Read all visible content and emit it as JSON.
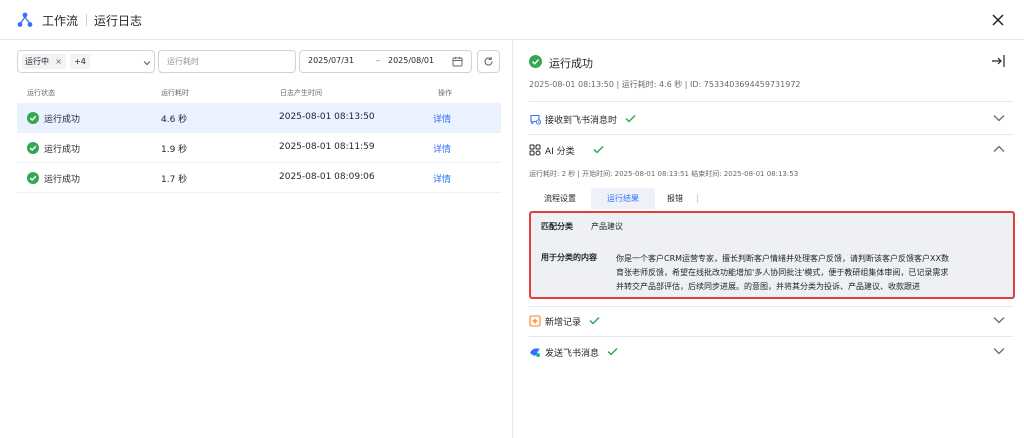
{
  "header": {
    "app_title": "工作流",
    "page_title": "运行日志"
  },
  "filters": {
    "status_tag": "运行中",
    "status_more": "+4",
    "duration_placeholder": "运行耗时",
    "date_start": "2025/07/31",
    "date_separator": "–",
    "date_end": "2025/08/01"
  },
  "table": {
    "columns": [
      "运行状态",
      "运行耗时",
      "日志产生时间",
      "操作"
    ],
    "rows": [
      {
        "status": "运行成功",
        "duration": "4.6 秒",
        "time": "2025-08-01 08:13:50",
        "action": "详情"
      },
      {
        "status": "运行成功",
        "duration": "1.9 秒",
        "time": "2025-08-01 08:11:59",
        "action": "详情"
      },
      {
        "status": "运行成功",
        "duration": "1.7 秒",
        "time": "2025-08-01 08:09:06",
        "action": "详情"
      }
    ]
  },
  "detail": {
    "status": "运行成功",
    "meta": "2025-08-01 08:13:50 | 运行耗时: 4.6 秒 | ID: 7533403694459731972",
    "sections": {
      "receive": "接收到飞书消息时",
      "ai": "AI 分类",
      "add_record": "新增记录",
      "send": "发送飞书消息"
    },
    "ai_meta": "运行耗时: 2 秒  |  开始时间: 2025-08-01 08:13:51  结束时间: 2025-08-01 08:13:53",
    "tabs": [
      "流程设置",
      "运行结果",
      "报错"
    ],
    "result": {
      "category_label": "匹配分类",
      "category_value": "产品建议",
      "content_label": "用于分类的内容",
      "content_lines": [
        "你是一个客户CRM运营专家，擅长判断客户情绪并处理客户反馈，请判断该客户反馈客户XX数",
        "育张老师反馈，希望在线批改功能增加'多人协同批注'模式，便于教研组集体审阅，已记录需求",
        "并转交产品部评估，后续同步进展。的意图，并将其分类为投诉、产品建议、收款跟进"
      ]
    }
  },
  "colors": {
    "accent": "#3370ff",
    "success": "#34a853",
    "highlight_border": "#e03d3d"
  }
}
